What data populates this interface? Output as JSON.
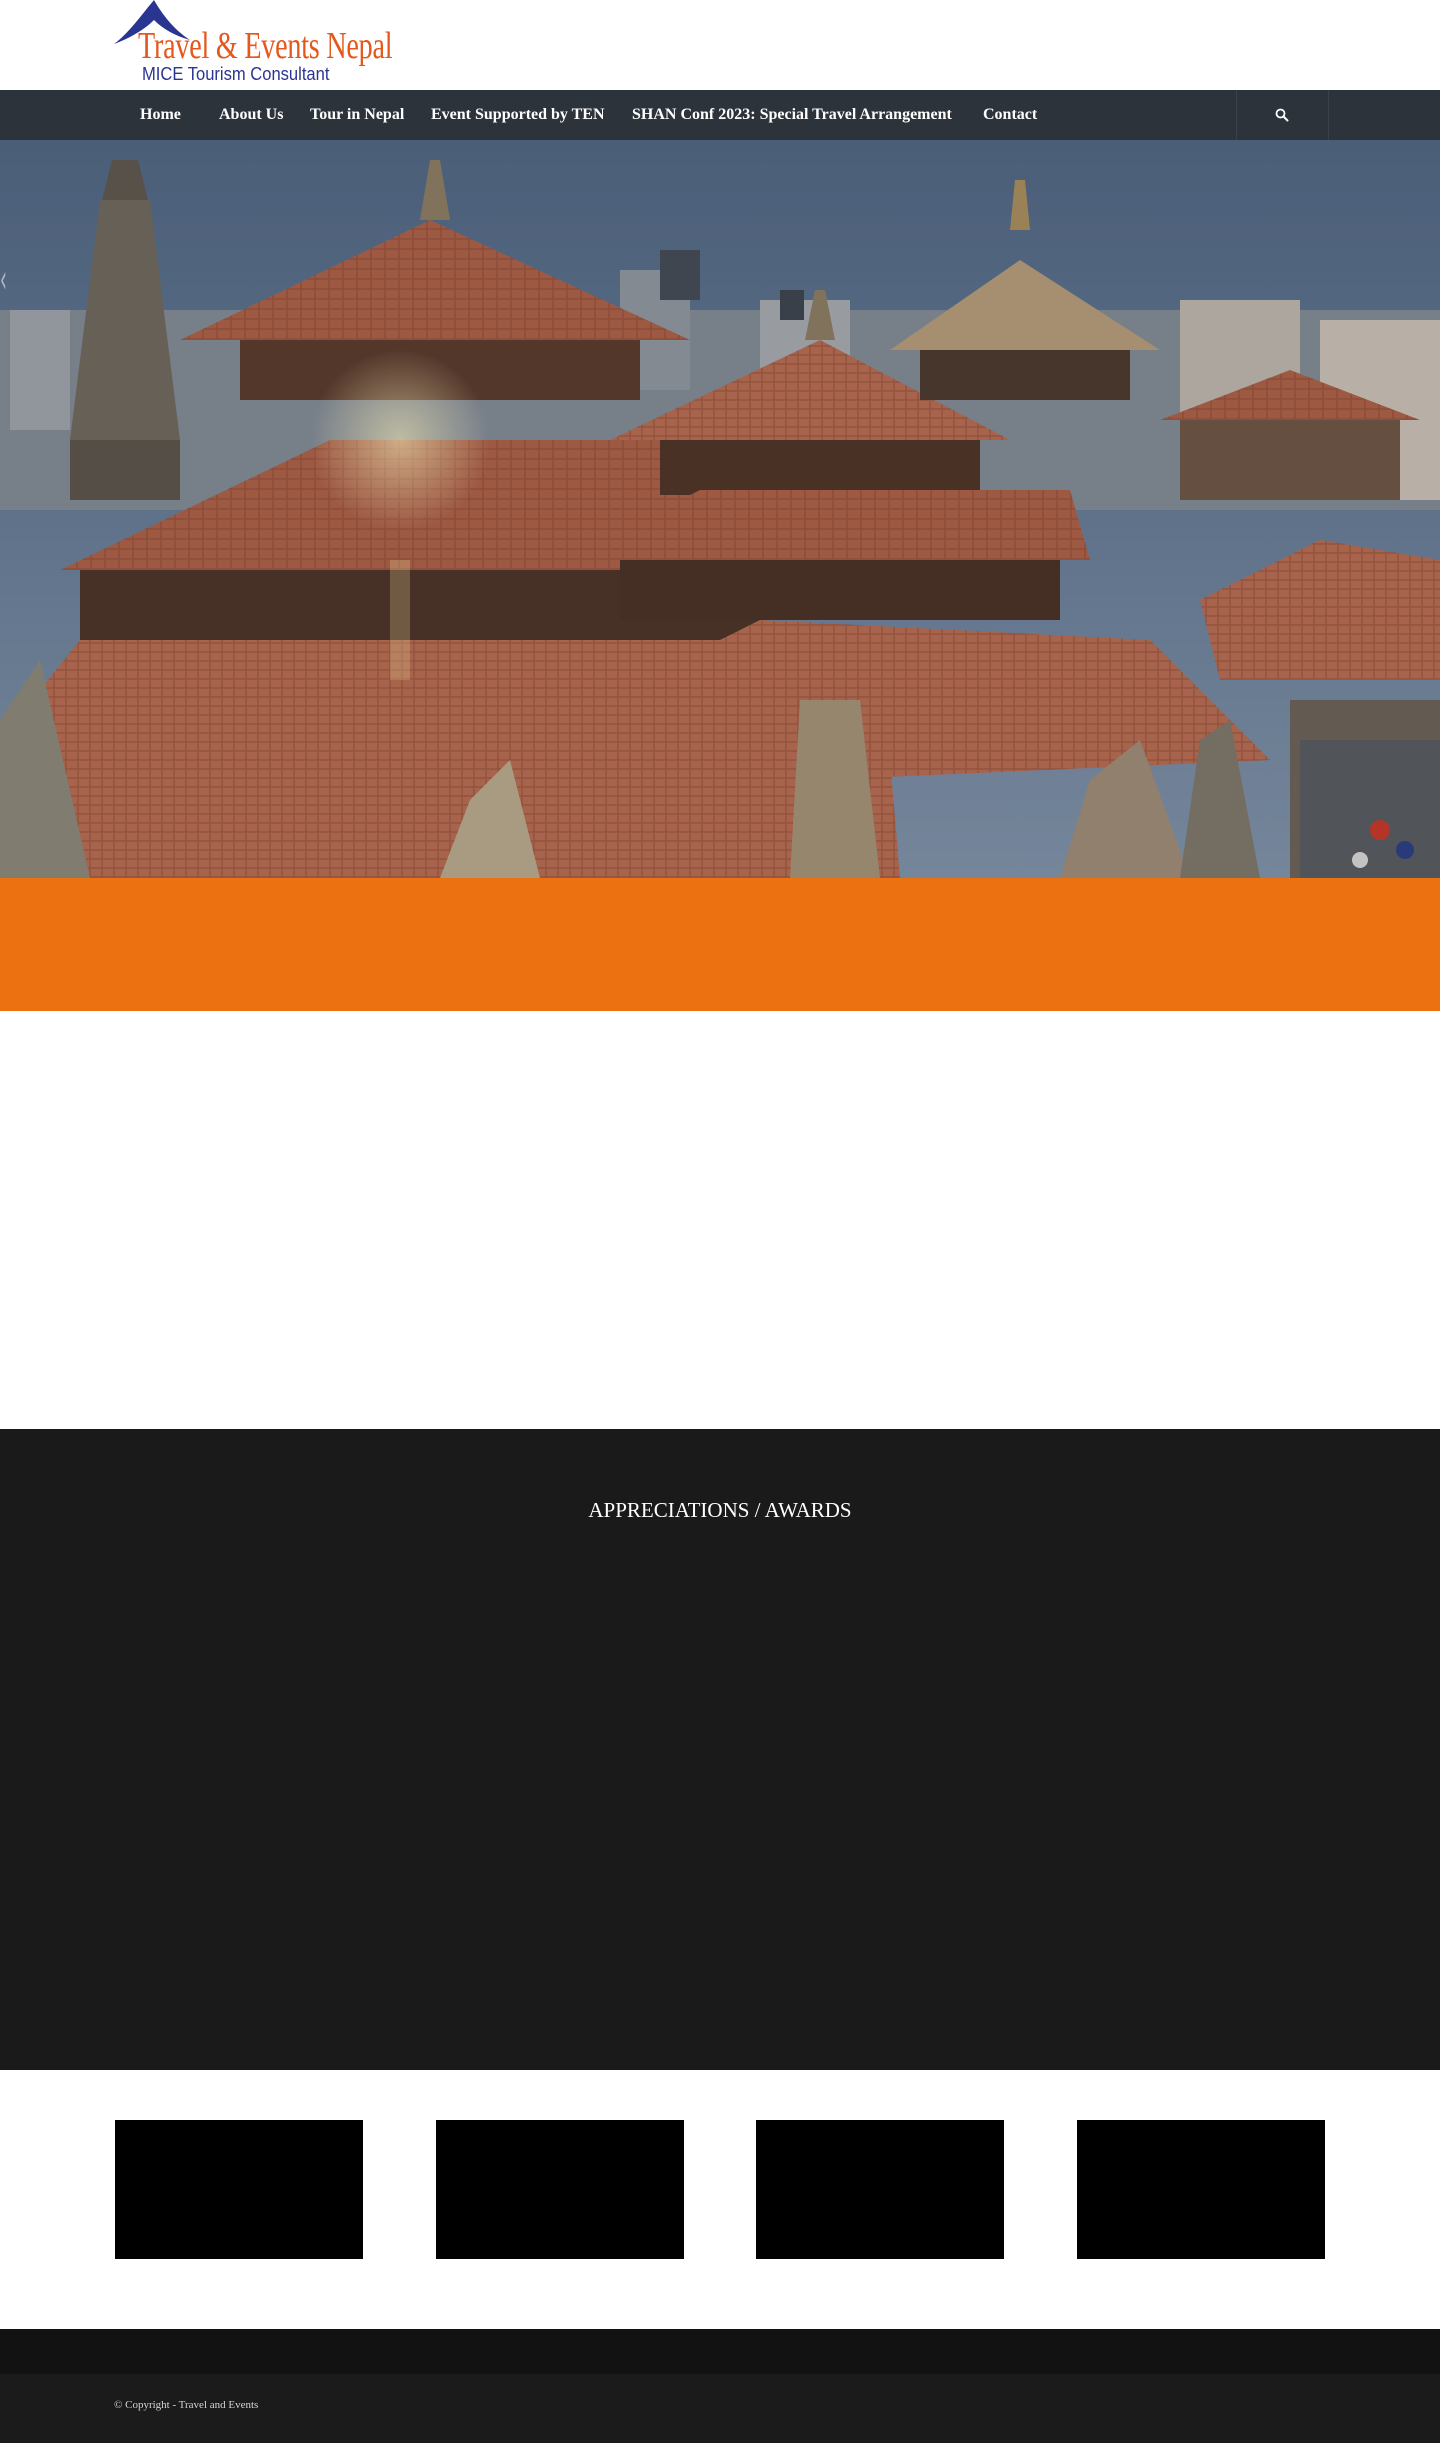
{
  "header": {
    "logo": {
      "icon": "pagoda-roof-icon",
      "name": "Travel & Events Nepal",
      "tagline": "MICE Tourism Consultant"
    }
  },
  "nav": {
    "items": [
      {
        "label": "Home"
      },
      {
        "label": "About Us"
      },
      {
        "label": "Tour in Nepal"
      },
      {
        "label": "Event Supported by TEN"
      },
      {
        "label": "SHAN Conf 2023: Special Travel Arrangement"
      },
      {
        "label": "Contact"
      }
    ],
    "search_icon": "search-icon"
  },
  "hero": {
    "image": "Pagoda temple rooftops of Patan Durbar Square",
    "prev_arrow": "‹"
  },
  "appreciations": {
    "title": "APPRECIATIONS / AWARDS"
  },
  "footer": {
    "copyright": "© Copyright - Travel and Events"
  },
  "colors": {
    "nav_bg": "#2d333b",
    "accent_orange": "#ec7211",
    "dark_section": "#1a1a1a",
    "logo_orange": "#e5581d",
    "logo_blue": "#2a3591"
  }
}
